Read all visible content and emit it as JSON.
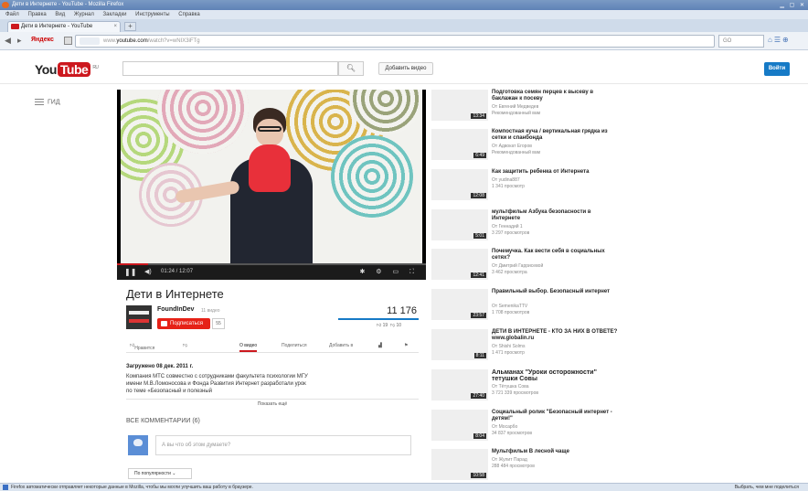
{
  "browser": {
    "title": "Дети в Интернете - YouTube - Mozilla Firefox",
    "menu": [
      "Файл",
      "Правка",
      "Вид",
      "Журнал",
      "Закладки",
      "Инструменты",
      "Справка"
    ],
    "tab_title": "Дети в Интернете - YouTube",
    "yandex_label": "Яндекс",
    "url_prefix": "www.",
    "url_domain": "youtube.com",
    "url_rest": "/watch?v=wNIX3iFTg",
    "search_placeholder": "GO",
    "status_text": "Firefox автоматически отправляет некоторые данные в Mozilla, чтобы мы могли улучшить ваш работу в браузере.",
    "status_right": "Выбрать, чем мне поделиться"
  },
  "yt": {
    "logo_you": "You",
    "logo_tube": "Tube",
    "logo_region": "RU",
    "upload_label": "Добавить видео",
    "login_label": "Войти",
    "guide_label": "ГИД"
  },
  "video": {
    "title": "Дети в Интернете",
    "time": "01:24 / 12:07",
    "progress": 0.1,
    "owner": "FoundInDev",
    "owner_videos": "11 видео",
    "subscribe_label": "Подписаться",
    "sub_count": "55",
    "views": "11 176",
    "likes": "19",
    "dislikes": "10",
    "actions": {
      "like": "Нравится",
      "about": "О видео",
      "share": "Поделиться",
      "add_to": "Добавить в"
    },
    "published": "Загружено 08 дек. 2011 г.",
    "description": "Компания МТС совместно с сотрудниками факультета психологии МГУ имени М.В.Ломоносова и Фонда Развития Интернет разработали урок по теме «Безопасный и полезный",
    "show_more": "Показать ещё",
    "comments_header": "ВСЕ КОММЕНТАРИИ (6)",
    "comment_placeholder": "А вы что об этом думаете?",
    "sort_label": "По популярности"
  },
  "related": [
    {
      "title": "Подготовка семян перцев к высеву в баклажан к посеву",
      "author": "От Евгений Медведев",
      "meta": "Рекомендованный вам",
      "duration": "13:34"
    },
    {
      "title": "Компостная куча / вертикальная грядка из сетки и спанбонда",
      "author": "От Адвокат Егоров",
      "meta": "Рекомендованный вам",
      "duration": "6:49"
    },
    {
      "title": "Как защитить ребенка от Интернета",
      "author": "От yudina887",
      "meta": "1 341 просмотр",
      "duration": "12:08"
    },
    {
      "title": "мультфильм Азбука безопасности в Интернете",
      "author": "От Геннадий 1",
      "meta": "3 297 просмотров",
      "duration": "5:01"
    },
    {
      "title": "Почемучка. Как вести себя в социальных сетях?",
      "author": "От Дмитрий Гаррисевой",
      "meta": "3 462 просмотра",
      "duration": "12:41"
    },
    {
      "title": "Правильный выбор. Безопасный интернет",
      "author": "От SemenikaTTV",
      "meta": "1 708 просмотров",
      "duration": "23:57"
    },
    {
      "title": "ДЕТИ В ИНТЕРНЕТЕ - КТО ЗА НИХ В ОТВЕТЕ?www.globalin.ru",
      "author": "От Shishi Solms",
      "meta": "1 471 просмотр",
      "duration": "8:11"
    },
    {
      "title": "Альманах \"Уроки осторожности\" тетушки Совы",
      "author": "От Тётушка Сова",
      "meta": "3 721 339 просмотров",
      "duration": "27:40"
    },
    {
      "title": "Социальный ролик \"Безопасный интернет - детям!\"",
      "author": "От Мосарбо",
      "meta": "34 837 просмотров",
      "duration": "8:04"
    },
    {
      "title": "Мультфильм В лесной чаще",
      "author": "От Жулит Парад",
      "meta": "288 484 просмотров",
      "duration": "10:58"
    }
  ],
  "colors": {
    "yt_red": "#cc181e",
    "login_blue": "#167ac6"
  }
}
